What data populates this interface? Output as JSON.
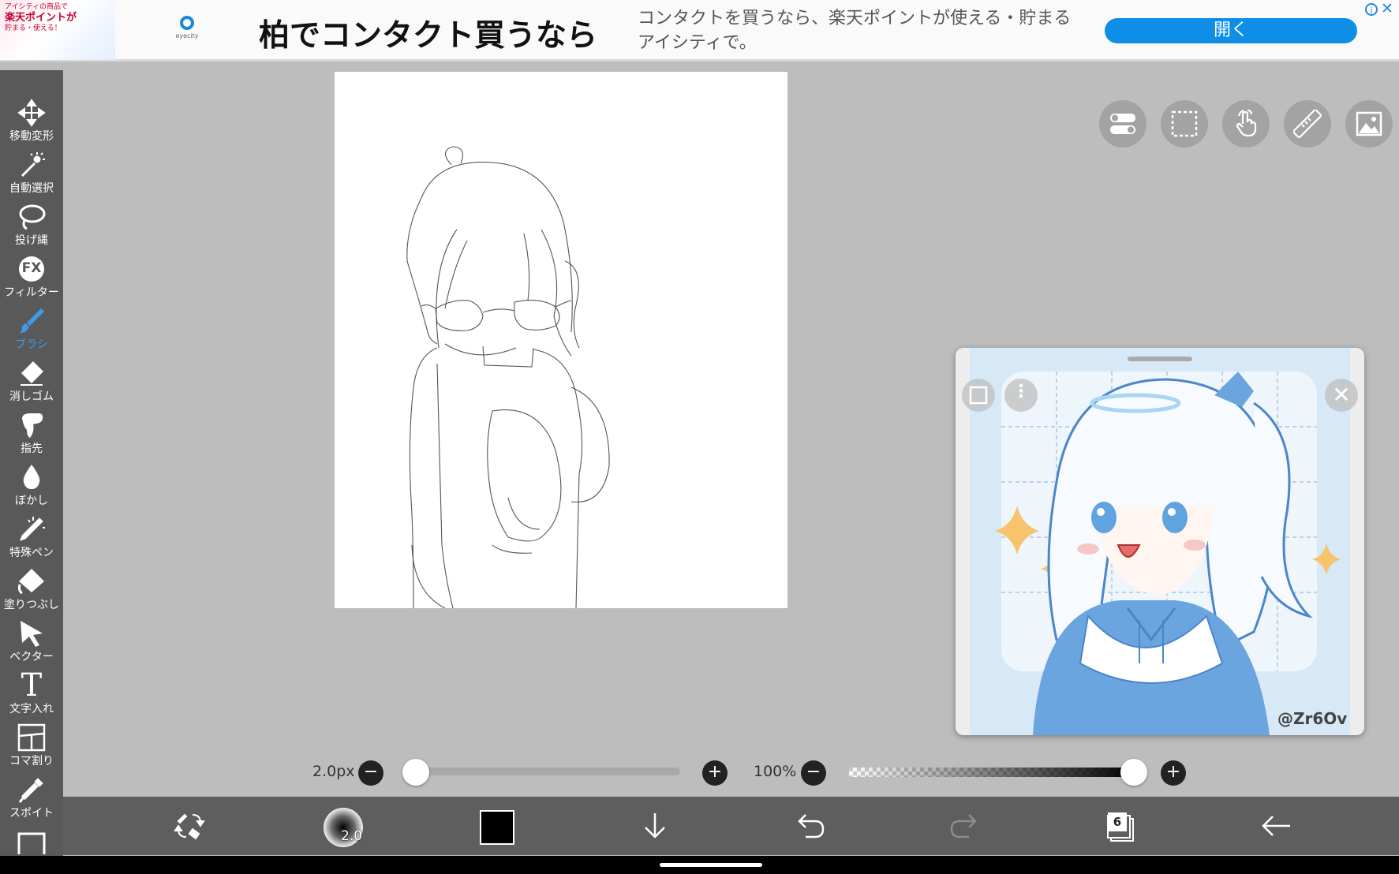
{
  "ad": {
    "thumb_line1": "アイシティの商品で",
    "thumb_line2": "楽天ポイントが",
    "thumb_line3": "貯まる・使える！",
    "logo_text": "eyecity",
    "headline": "柏でコンタクト買うなら",
    "description": "コンタクトを買うなら、楽天ポイントが使える・貯まるアイシティで。",
    "cta": "開く",
    "info_icon": "i",
    "close_icon": "✕"
  },
  "toolbar": {
    "items": [
      {
        "label": "移動変形",
        "icon": "move-transform-icon"
      },
      {
        "label": "自動選択",
        "icon": "magic-wand-icon"
      },
      {
        "label": "投げ縄",
        "icon": "lasso-icon"
      },
      {
        "label": "フィルター",
        "icon": "fx-filter-icon"
      },
      {
        "label": "ブラシ",
        "icon": "brush-icon",
        "active": true
      },
      {
        "label": "消しゴム",
        "icon": "eraser-icon"
      },
      {
        "label": "指先",
        "icon": "finger-smudge-icon"
      },
      {
        "label": "ぼかし",
        "icon": "blur-drop-icon"
      },
      {
        "label": "特殊ペン",
        "icon": "special-pen-icon"
      },
      {
        "label": "塗りつぶし",
        "icon": "bucket-fill-icon"
      },
      {
        "label": "ベクター",
        "icon": "vector-cursor-icon"
      },
      {
        "label": "文字入れ",
        "icon": "text-tool-icon"
      },
      {
        "label": "コマ割り",
        "icon": "frame-divider-icon"
      },
      {
        "label": "スポイト",
        "icon": "eyedropper-icon"
      }
    ],
    "fx_text": "FX",
    "text_glyph": "T"
  },
  "reference": {
    "credit": "@Zr6Ov",
    "more_glyph": "⋮",
    "close_glyph": "✕"
  },
  "controls": {
    "brush_size": "2.0px",
    "brush_size_fraction": 0.0,
    "opacity": "100%",
    "opacity_fraction": 1.0,
    "minus_glyph": "−",
    "plus_glyph": "+"
  },
  "bottombar": {
    "brush_preview_value": "2.0",
    "current_color": "#000000",
    "layer_count": "6"
  },
  "colors": {
    "accent": "#3d9be9",
    "toolbar_bg": "#595959",
    "workspace_bg": "#bdbdbd",
    "ad_button": "#0f8ee8"
  }
}
